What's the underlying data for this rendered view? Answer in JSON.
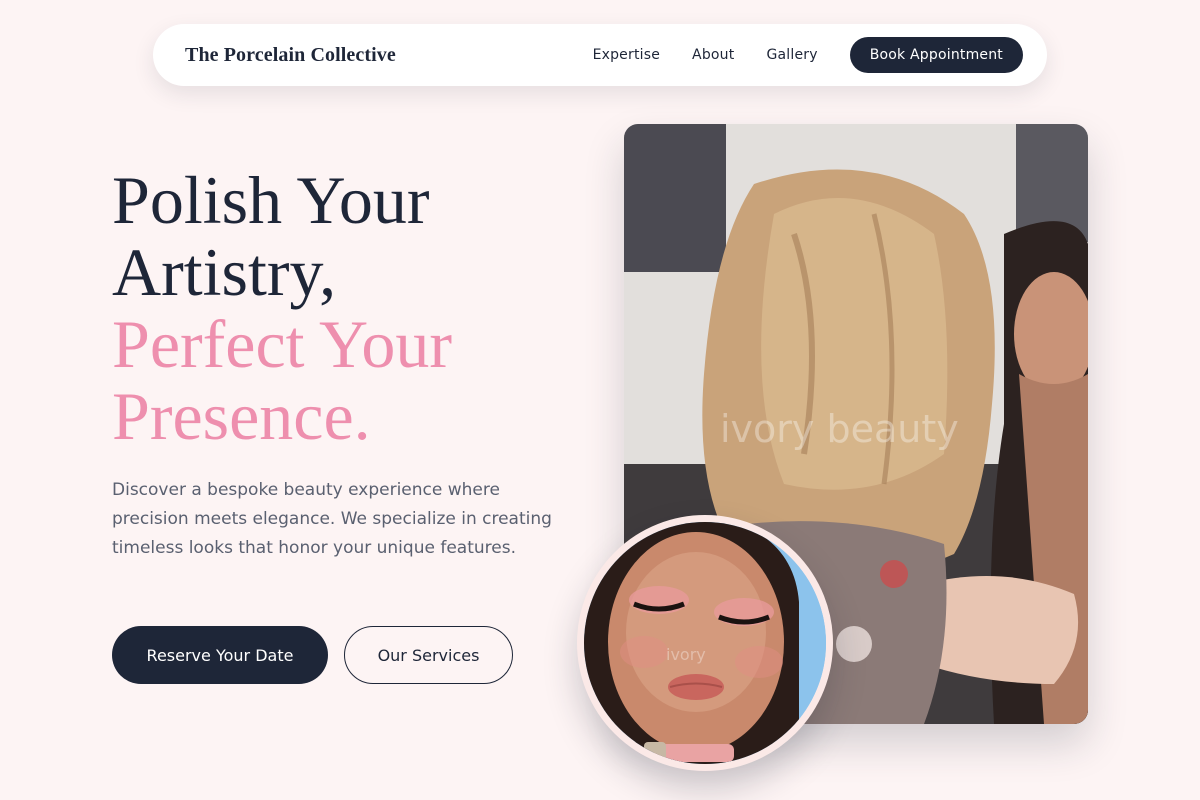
{
  "nav": {
    "brand": "The Porcelain Collective",
    "links": [
      "Expertise",
      "About",
      "Gallery"
    ],
    "cta": "Book Appointment"
  },
  "hero": {
    "headline_dark": [
      "Polish Your",
      "Artistry,"
    ],
    "headline_accent": [
      "Perfect Your",
      "Presence."
    ],
    "description": "Discover a bespoke beauty experience where precision meets elegance. We specialize in creating timeless looks that honor your unique features.",
    "primary_button": "Reserve Your Date",
    "secondary_button": "Our Services"
  },
  "images": {
    "main_photo": "photo-makeup-artist-at-work",
    "main_photo_watermark": "ivory beauty",
    "round_photo": "photo-makeup-closeup-portrait",
    "round_photo_watermark": "ivory"
  },
  "colors": {
    "background": "#fdf4f4",
    "navy": "#1e2638",
    "accent_pink": "#ee8fae",
    "body_text": "#5a6070"
  }
}
